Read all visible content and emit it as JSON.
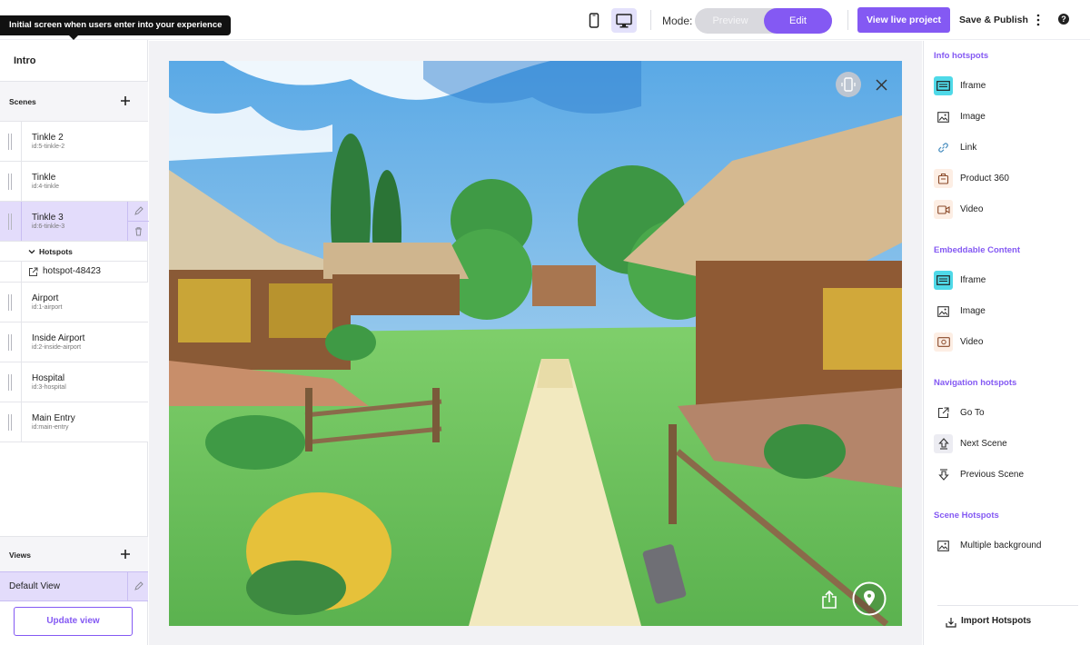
{
  "tooltip": "Initial screen when users enter into your experience",
  "header": {
    "mode_label": "Mode:",
    "mode_options": {
      "preview": "Preview",
      "edit": "Edit"
    },
    "active_mode": "Edit",
    "view_live_label": "View live project",
    "save_publish_label": "Save & Publish",
    "icons": [
      "mobile-icon",
      "desktop-icon",
      "more-vertical-icon",
      "help-icon"
    ]
  },
  "left": {
    "intro": "Intro",
    "scenes_label": "Scenes",
    "scenes": [
      {
        "name": "Tinkle 2",
        "id": "id:5-tinkle-2"
      },
      {
        "name": "Tinkle",
        "id": "id:4-tinkle"
      },
      {
        "name": "Tinkle 3",
        "id": "id:6-tinkle-3"
      },
      {
        "name": "Airport",
        "id": "id:1-airport"
      },
      {
        "name": "Inside Airport",
        "id": "id:2-inside-airport"
      },
      {
        "name": "Hospital",
        "id": "id:3-hospital"
      },
      {
        "name": "Main Entry",
        "id": "id:main-entry"
      }
    ],
    "selected_scene": "Tinkle 3",
    "hotspots_label": "Hotspots",
    "hotspot_item": "hotspot-48423",
    "views_label": "Views",
    "default_view": "Default View",
    "update_view": "Update view"
  },
  "right": {
    "info_title": "Info hotspots",
    "info_items": [
      "Iframe",
      "Image",
      "Link",
      "Product 360",
      "Video"
    ],
    "embed_title": "Embeddable Content",
    "embed_items": [
      "Iframe",
      "Image",
      "Video"
    ],
    "nav_title": "Navigation hotspots",
    "nav_items": [
      "Go To",
      "Next Scene",
      "Previous Scene"
    ],
    "scene_title": "Scene Hotspots",
    "scene_items": [
      "Multiple background"
    ],
    "import_label": "Import Hotspots"
  },
  "colors": {
    "accent": "#8459f3",
    "selected_bg": "#e3dcfb",
    "iframe_icon_bg": "#4fd9e8"
  }
}
